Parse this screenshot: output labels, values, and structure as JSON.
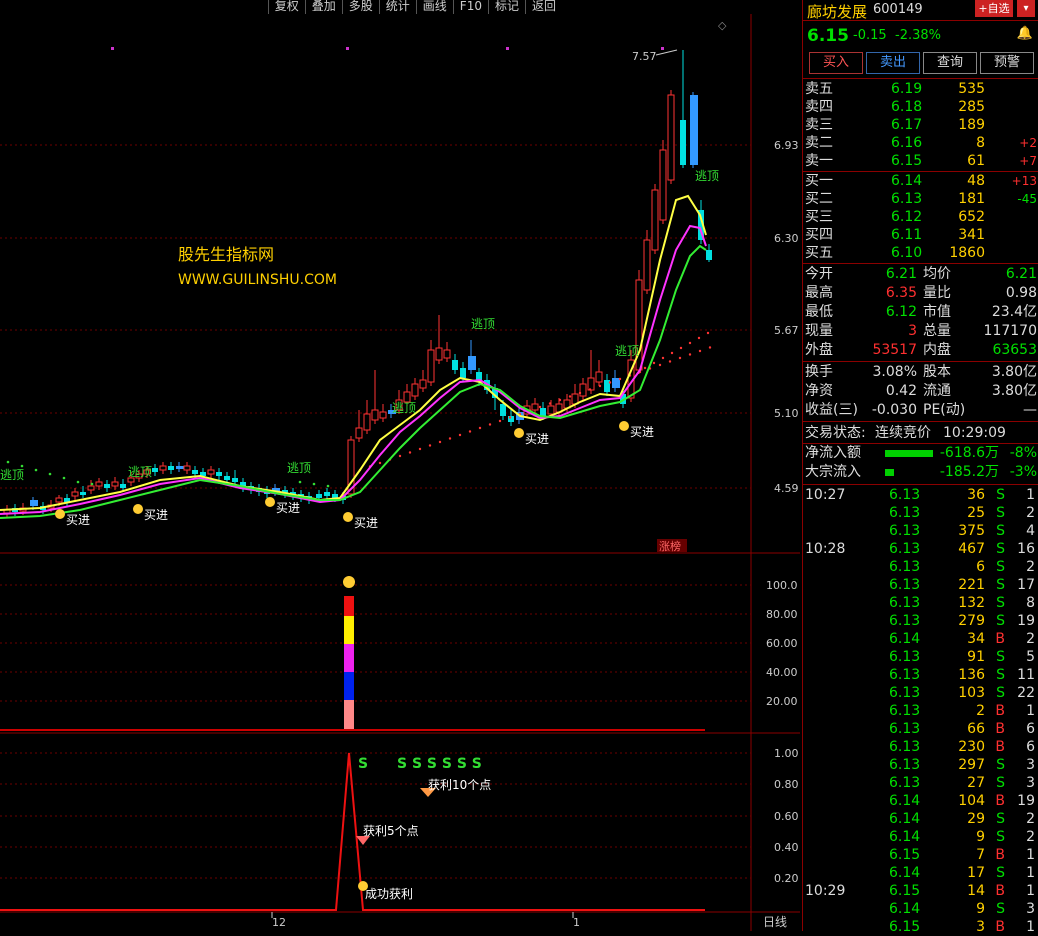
{
  "toolbar": [
    "复权",
    "叠加",
    "多股",
    "统计",
    "画线",
    "F10",
    "标记",
    "返回"
  ],
  "stock": {
    "name": "廊坊发展",
    "code": "600149",
    "price": "6.15",
    "change": "-0.15",
    "pct": "-2.38%",
    "watch_label": "+自选",
    "watch_drop": "▾",
    "bell_icon": "bell-icon"
  },
  "trade_buttons": [
    "买入",
    "卖出",
    "查询",
    "预警"
  ],
  "asks": [
    {
      "label": "卖五",
      "price": "6.19",
      "vol": "535",
      "delta": ""
    },
    {
      "label": "卖四",
      "price": "6.18",
      "vol": "285",
      "delta": ""
    },
    {
      "label": "卖三",
      "price": "6.17",
      "vol": "189",
      "delta": ""
    },
    {
      "label": "卖二",
      "price": "6.16",
      "vol": "8",
      "delta": "+2"
    },
    {
      "label": "卖一",
      "price": "6.15",
      "vol": "61",
      "delta": "+7"
    }
  ],
  "bids": [
    {
      "label": "买一",
      "price": "6.14",
      "vol": "48",
      "delta": "+13"
    },
    {
      "label": "买二",
      "price": "6.13",
      "vol": "181",
      "delta": "-45"
    },
    {
      "label": "买三",
      "price": "6.12",
      "vol": "652",
      "delta": ""
    },
    {
      "label": "买四",
      "price": "6.11",
      "vol": "341",
      "delta": ""
    },
    {
      "label": "买五",
      "price": "6.10",
      "vol": "1860",
      "delta": ""
    }
  ],
  "stats": [
    {
      "l1": "今开",
      "v1": "6.21",
      "l2": "均价",
      "v2": "6.21"
    },
    {
      "l1": "最高",
      "v1": "6.35",
      "l2": "量比",
      "v2": "0.98"
    },
    {
      "l1": "最低",
      "v1": "6.12",
      "l2": "市值",
      "v2": "23.4亿"
    },
    {
      "l1": "现量",
      "v1": "3",
      "l2": "总量",
      "v2": "117170"
    },
    {
      "l1": "外盘",
      "v1": "53517",
      "l2": "内盘",
      "v2": "63653"
    }
  ],
  "stats2": [
    {
      "l1": "换手",
      "v1": "3.08%",
      "l2": "股本",
      "v2": "3.80亿"
    },
    {
      "l1": "净资",
      "v1": "0.42",
      "l2": "流通",
      "v2": "3.80亿"
    },
    {
      "l1": "收益(三)",
      "v1": "-0.030",
      "l2": "PE(动)",
      "v2": "—"
    }
  ],
  "status": {
    "label": "交易状态:",
    "value": "连续竞价",
    "time": "10:29:09"
  },
  "flows": [
    {
      "label": "净流入额",
      "value": "-618.6万",
      "pct": "-8%",
      "bar": 0.8
    },
    {
      "label": "大宗流入",
      "value": "-185.2万",
      "pct": "-3%",
      "bar": 0.15
    }
  ],
  "ticks": [
    {
      "time": "10:27",
      "price": "6.13",
      "vol": "36",
      "side": "S",
      "n": "1"
    },
    {
      "time": "",
      "price": "6.13",
      "vol": "25",
      "side": "S",
      "n": "2"
    },
    {
      "time": "",
      "price": "6.13",
      "vol": "375",
      "side": "S",
      "n": "4"
    },
    {
      "time": "10:28",
      "price": "6.13",
      "vol": "467",
      "side": "S",
      "n": "16"
    },
    {
      "time": "",
      "price": "6.13",
      "vol": "6",
      "side": "S",
      "n": "2"
    },
    {
      "time": "",
      "price": "6.13",
      "vol": "221",
      "side": "S",
      "n": "17"
    },
    {
      "time": "",
      "price": "6.13",
      "vol": "132",
      "side": "S",
      "n": "8"
    },
    {
      "time": "",
      "price": "6.13",
      "vol": "279",
      "side": "S",
      "n": "19"
    },
    {
      "time": "",
      "price": "6.14",
      "vol": "34",
      "side": "B",
      "n": "2"
    },
    {
      "time": "",
      "price": "6.13",
      "vol": "91",
      "side": "S",
      "n": "5"
    },
    {
      "time": "",
      "price": "6.13",
      "vol": "136",
      "side": "S",
      "n": "11"
    },
    {
      "time": "",
      "price": "6.13",
      "vol": "103",
      "side": "S",
      "n": "22"
    },
    {
      "time": "",
      "price": "6.13",
      "vol": "2",
      "side": "B",
      "n": "1"
    },
    {
      "time": "",
      "price": "6.13",
      "vol": "66",
      "side": "B",
      "n": "6"
    },
    {
      "time": "",
      "price": "6.13",
      "vol": "230",
      "side": "B",
      "n": "6"
    },
    {
      "time": "",
      "price": "6.13",
      "vol": "297",
      "side": "S",
      "n": "3"
    },
    {
      "time": "",
      "price": "6.13",
      "vol": "27",
      "side": "S",
      "n": "3"
    },
    {
      "time": "",
      "price": "6.14",
      "vol": "104",
      "side": "B",
      "n": "19"
    },
    {
      "time": "",
      "price": "6.14",
      "vol": "29",
      "side": "S",
      "n": "2"
    },
    {
      "time": "",
      "price": "6.14",
      "vol": "9",
      "side": "S",
      "n": "2"
    },
    {
      "time": "",
      "price": "6.15",
      "vol": "7",
      "side": "B",
      "n": "1"
    },
    {
      "time": "",
      "price": "6.14",
      "vol": "17",
      "side": "S",
      "n": "1"
    },
    {
      "time": "10:29",
      "price": "6.15",
      "vol": "14",
      "side": "B",
      "n": "1"
    },
    {
      "time": "",
      "price": "6.14",
      "vol": "9",
      "side": "S",
      "n": "3"
    },
    {
      "time": "",
      "price": "6.15",
      "vol": "3",
      "side": "B",
      "n": "1"
    }
  ],
  "chart": {
    "watermark1": "股先生指标网",
    "watermark2": "WWW.GUILINSHU.COM",
    "price_ticks": [
      "6.93",
      "6.30",
      "5.67",
      "5.10",
      "4.59"
    ],
    "high_label": "7.57",
    "limitup_label": "涨榜",
    "escape_label": "逃顶",
    "buy_label": "买进",
    "ind1_ticks": [
      "100.0",
      "80.00",
      "60.00",
      "40.00",
      "20.00"
    ],
    "ind2_ticks": [
      "1.00",
      "0.80",
      "0.60",
      "0.40",
      "0.20"
    ],
    "signal_s": "S",
    "signal_s_group": "S S S S S S",
    "profit10": "获利10个点",
    "profit5": "获利5个点",
    "profit_ok": "成功获利",
    "x_labels": [
      "12",
      "1"
    ],
    "period": "日线"
  }
}
